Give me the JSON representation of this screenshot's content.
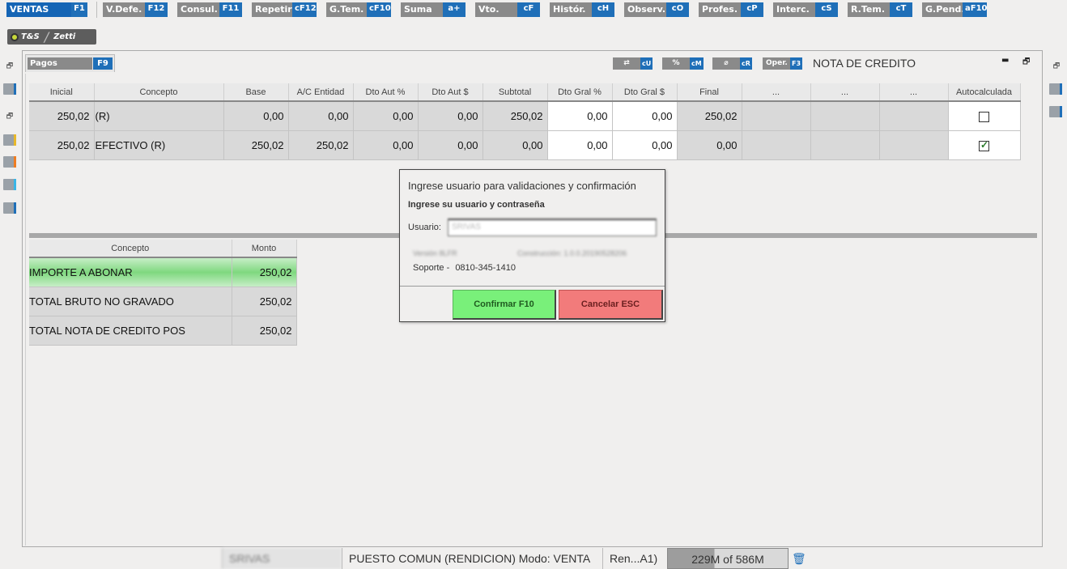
{
  "toolbar": {
    "buttons": [
      {
        "label": "VENTAS",
        "key": "F1"
      },
      {
        "label": "V.Defe.",
        "key": "F12"
      },
      {
        "label": "Consul.",
        "key": "F11"
      },
      {
        "label": "Repetir",
        "key": "cF12"
      },
      {
        "label": "G.Tem.",
        "key": "cF10"
      },
      {
        "label": "Suma",
        "key": "a+"
      },
      {
        "label": "Vto.",
        "key": "cF"
      },
      {
        "label": "Histór.",
        "key": "cH"
      },
      {
        "label": "Observ.",
        "key": "cO"
      },
      {
        "label": "Profes.",
        "key": "cP"
      },
      {
        "label": "Interc.",
        "key": "cS"
      },
      {
        "label": "R.Tem.",
        "key": "cT"
      },
      {
        "label": "G.Pend.",
        "key": "aF10"
      }
    ]
  },
  "logo": {
    "left": "T&S",
    "right": "Zetti"
  },
  "pagos_tab": {
    "label": "Pagos",
    "key": "F9"
  },
  "controls": {
    "swap": {
      "label": "⇄",
      "key": "cU"
    },
    "percent": {
      "label": "%",
      "key": "cM"
    },
    "zero": {
      "label": "⌀",
      "key": "cR"
    },
    "oper": {
      "label": "Oper.",
      "key": "F3"
    }
  },
  "section_title": "NOTA DE CREDITO",
  "payments": {
    "headers": [
      "Inicial",
      "Concepto",
      "Base",
      "A/C Entidad",
      "Dto Aut %",
      "Dto Aut $",
      "Subtotal",
      "Dto Gral %",
      "Dto Gral $",
      "Final",
      "...",
      "...",
      "...",
      "Autocalculada"
    ],
    "rows": [
      {
        "inicial": "250,02",
        "concepto": "(R)",
        "base": "0,00",
        "ac_entidad": "0,00",
        "dto_aut_pct": "0,00",
        "dto_aut_amt": "0,00",
        "subtotal": "250,02",
        "dto_gral_pct": "0,00",
        "dto_gral_amt": "0,00",
        "final": "250,02",
        "autocalculada": false
      },
      {
        "inicial": "250,02",
        "concepto": "EFECTIVO (R)",
        "base": "250,02",
        "ac_entidad": "250,02",
        "dto_aut_pct": "0,00",
        "dto_aut_amt": "0,00",
        "subtotal": "0,00",
        "dto_gral_pct": "0,00",
        "dto_gral_amt": "0,00",
        "final": "0,00",
        "autocalculada": true
      }
    ]
  },
  "totals": {
    "headers": [
      "Concepto",
      "Monto"
    ],
    "rows": [
      {
        "concepto": "IMPORTE A ABONAR",
        "monto": "250,02"
      },
      {
        "concepto": "TOTAL BRUTO NO GRAVADO",
        "monto": "250,02"
      },
      {
        "concepto": "TOTAL NOTA DE CREDITO POS",
        "monto": "250,02"
      }
    ]
  },
  "dialog": {
    "title": "Ingrese usuario para validaciones y confirmación",
    "subtitle": "Ingrese su usuario y contraseña",
    "user_label": "Usuario:",
    "user_value": "SRIVAS",
    "version_text": "Versión 8LFR",
    "build_text": "Construcción: 1.0.0.20190528206",
    "soporte_label": "Soporte -",
    "soporte_phone": "0810-345-1410",
    "confirm_label": "Confirmar  F10",
    "cancel_label": "Cancelar  ESC"
  },
  "status_bar": {
    "user": "SRIVAS",
    "puesto": "PUESTO COMUN (RENDICION) Modo: VENTA",
    "ren": "Ren...A1)",
    "memory": "229M of 586M",
    "memory_used_fraction": 0.39
  }
}
